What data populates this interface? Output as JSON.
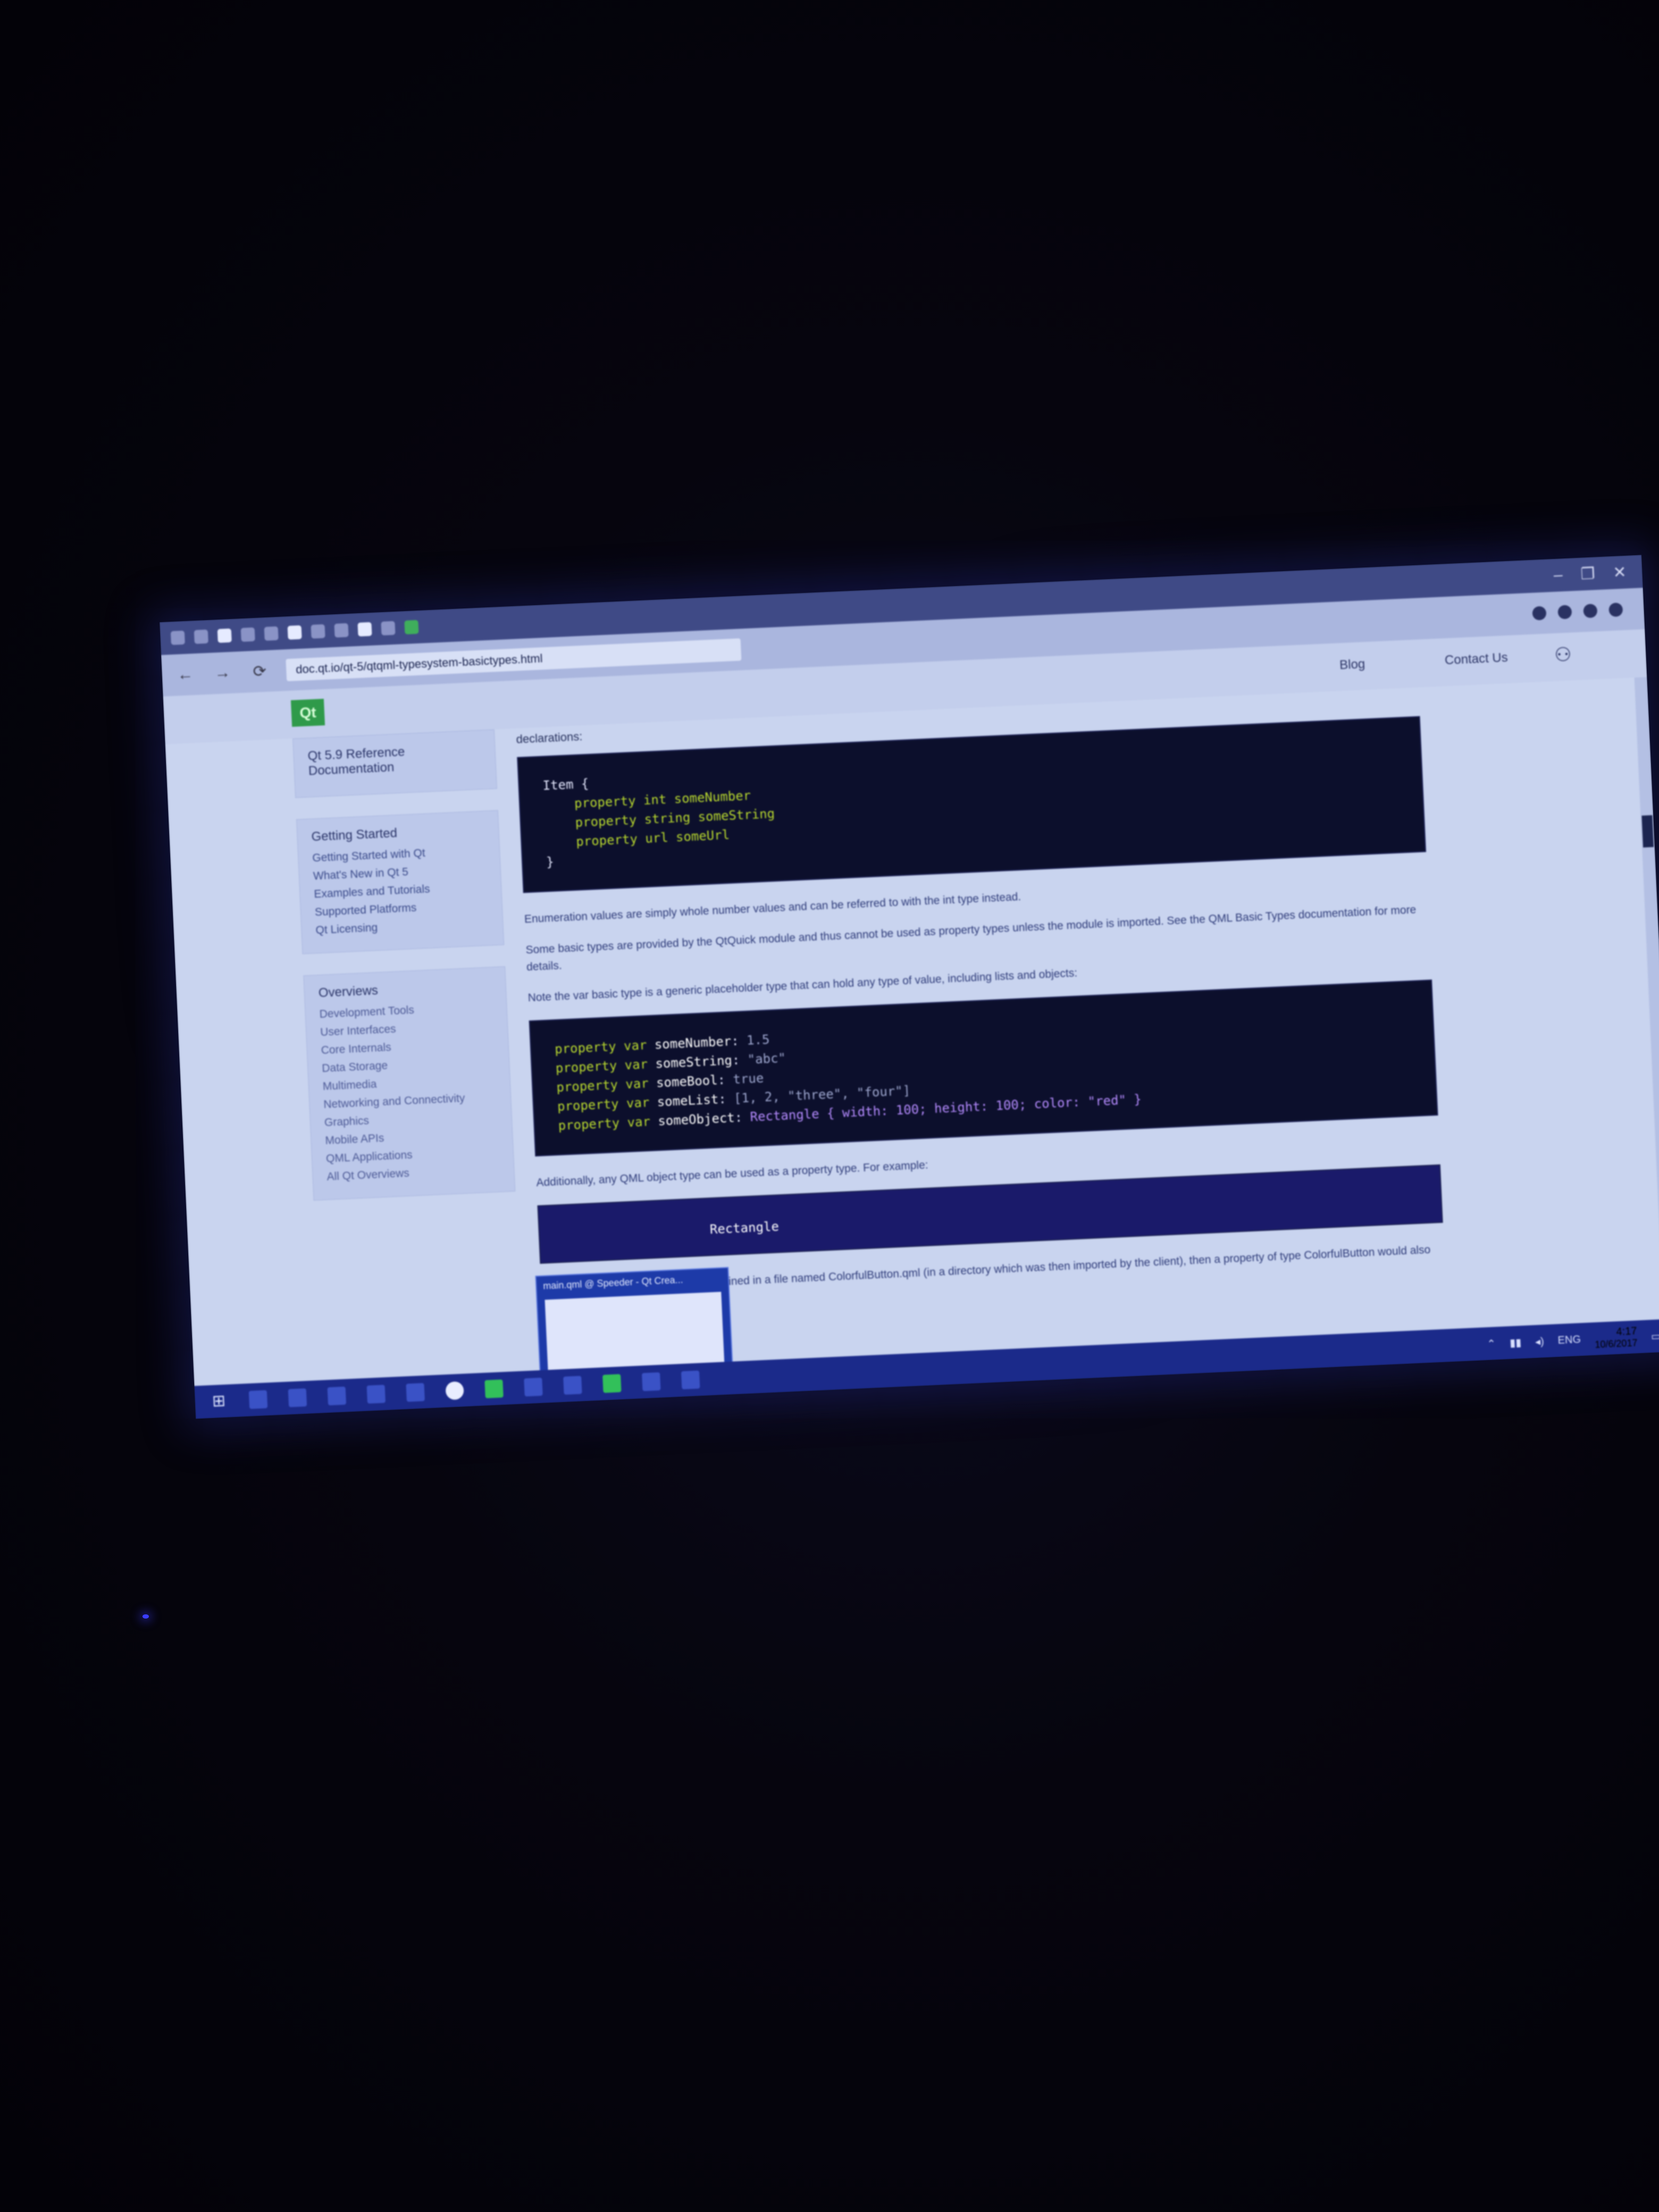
{
  "browser": {
    "url": "doc.qt.io/qt-5/qtqml-typesystem-basictypes.html",
    "window_controls": [
      "–",
      "❐",
      "✕"
    ]
  },
  "site": {
    "logo_text": "Qt",
    "header_links": [
      "Blog",
      "Contact Us"
    ]
  },
  "sidebar": {
    "reference": {
      "title": "Qt 5.9 Reference Documentation"
    },
    "getting_started": {
      "title": "Getting Started",
      "items": [
        "Getting Started with Qt",
        "What's New in Qt 5",
        "Examples and Tutorials",
        "Supported Platforms",
        "Qt Licensing"
      ]
    },
    "overviews": {
      "title": "Overviews",
      "items": [
        "Development Tools",
        "User Interfaces",
        "Core Internals",
        "Data Storage",
        "Multimedia",
        "Networking and Connectivity",
        "Graphics",
        "Mobile APIs",
        "QML Applications",
        "All Qt Overviews"
      ]
    }
  },
  "content": {
    "section_label": "declarations:",
    "code1": [
      "Item {",
      "    property int someNumber",
      "    property string someString",
      "    property url someUrl",
      "}"
    ],
    "para1": "Enumeration values are simply whole number values and can be referred to with the int type instead.",
    "para2": "Some basic types are provided by the QtQuick module and thus cannot be used as property types unless the module is imported. See the QML Basic Types documentation for more details.",
    "para3": "Note the var basic type is a generic placeholder type that can hold any type of value, including lists and objects:",
    "code2": {
      "prefix": "property var ",
      "lines": [
        {
          "name": "someNumber",
          "value": "1.5"
        },
        {
          "name": "someString",
          "value": "\"abc\""
        },
        {
          "name": "someBool",
          "value": "true"
        },
        {
          "name": "someList",
          "value": "[1, 2, \"three\", \"four\"]"
        },
        {
          "name": "someObject",
          "value": "Rectangle { width: 100; height: 100; color: \"red\" }"
        }
      ]
    },
    "para4": "Additionally, any QML object type can be used as a property type. For example:",
    "code3_tail": "Rectangle",
    "para5": "...types as well. If a QML type was defined in a file named ColorfulButton.qml (in a directory which was then imported by the client), then a property of type ColorfulButton would also be valid."
  },
  "preview": {
    "title": "main.qml @ Speeder - Qt Crea..."
  },
  "taskbar": {
    "start_glyph": "⊞",
    "tray_lang": "ENG",
    "time": "4:17",
    "date": "10/6/2017"
  }
}
